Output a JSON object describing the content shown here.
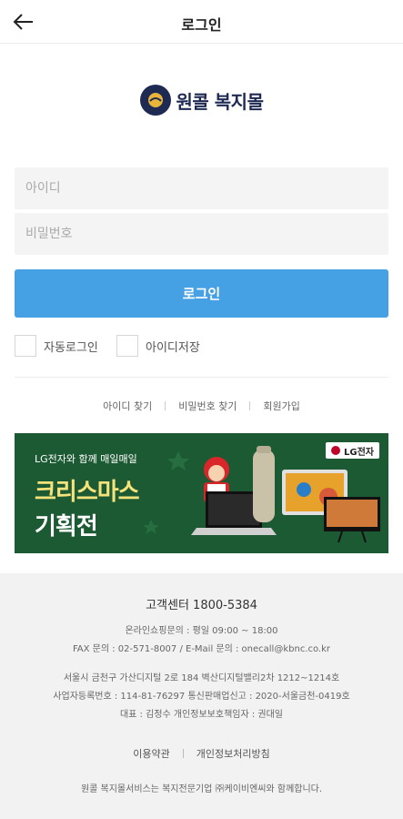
{
  "header": {
    "title": "로그인"
  },
  "logo": {
    "text": "원콜 복지몰"
  },
  "form": {
    "id_placeholder": "아이디",
    "pw_placeholder": "비밀번호",
    "login_label": "로그인",
    "auto_login_label": "자동로그인",
    "save_id_label": "아이디저장"
  },
  "links": {
    "find_id": "아이디 찾기",
    "find_pw": "비밀번호 찾기",
    "signup": "회원가입"
  },
  "banner": {
    "subtitle": "LG전자와 함께 매일매일",
    "title_line1": "크리스마스",
    "title_line2": "기획전",
    "brand": "LG전자"
  },
  "footer": {
    "customer_center": "고객센터 1800-5384",
    "hours": "온라인쇼핑문의 : 평일 09:00 ~ 18:00",
    "contact": "FAX 문의 : 02-571-8007 / E-Mail 문의 : onecall@kbnc.co.kr",
    "address": "서울시 금천구 가산디지털 2로 184 벽산디지털밸리2차 1212~1214호",
    "registration": "사업자등록번호 : 114-81-76297 통신판매업신고 : 2020-서울금천-0419호",
    "representative": "대표 : 김정수 개인정보보호책임자 : 권대일",
    "terms": "이용약관",
    "privacy": "개인정보처리방침",
    "notice": "원콜 복지몰서비스는 복지전문기업 ㈜케이비엔씨와 함께합니다."
  }
}
